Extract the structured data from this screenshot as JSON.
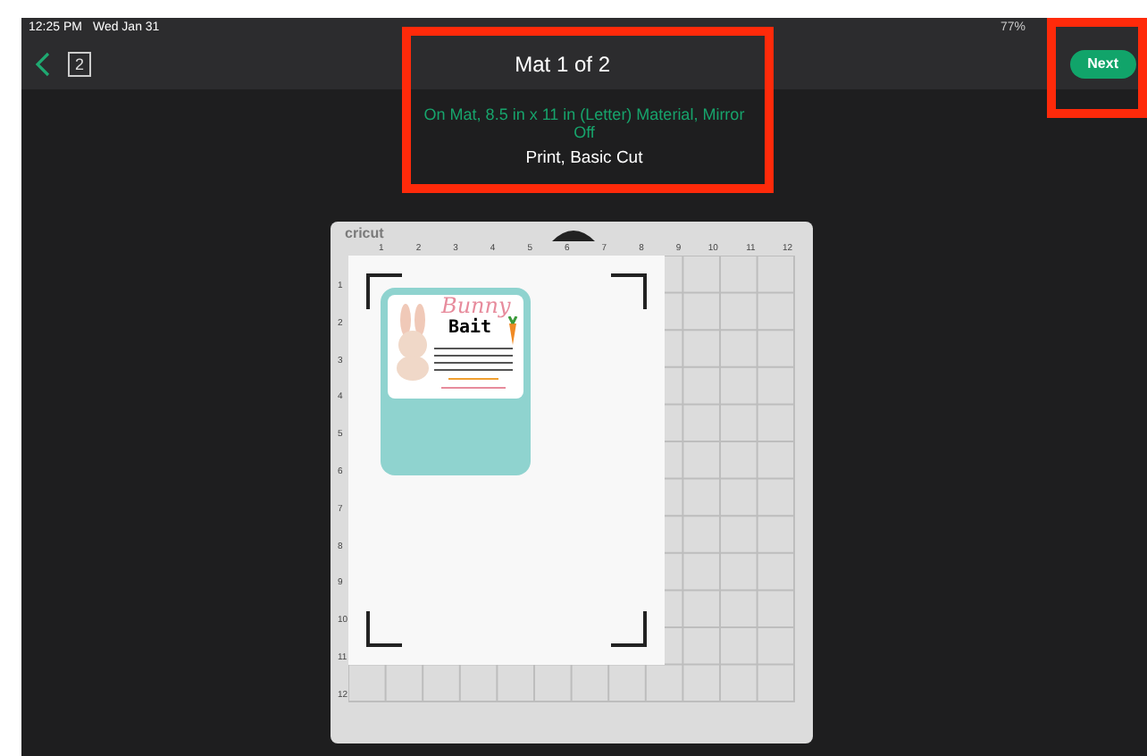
{
  "status_bar": {
    "time": "12:25 PM",
    "date": "Wed Jan 31",
    "battery": "77%"
  },
  "header": {
    "mat_count": "2",
    "title": "Mat 1 of 2",
    "title_highlighted": true,
    "next_button": "Next",
    "next_highlighted": true
  },
  "mat_info": {
    "material": "On Mat, 8.5 in x 11 in (Letter) Material, Mirror Off",
    "operation": "Print, Basic Cut"
  },
  "mat": {
    "brand": "cricut",
    "top_ruler": [
      "1",
      "2",
      "3",
      "4",
      "5",
      "6",
      "7",
      "8",
      "9",
      "10",
      "11",
      "12"
    ],
    "left_ruler": [
      "1",
      "2",
      "3",
      "4",
      "5",
      "6",
      "7",
      "8",
      "9",
      "10",
      "11",
      "12"
    ],
    "design": {
      "title_1": "Bunny",
      "title_2": "Bait"
    }
  }
}
